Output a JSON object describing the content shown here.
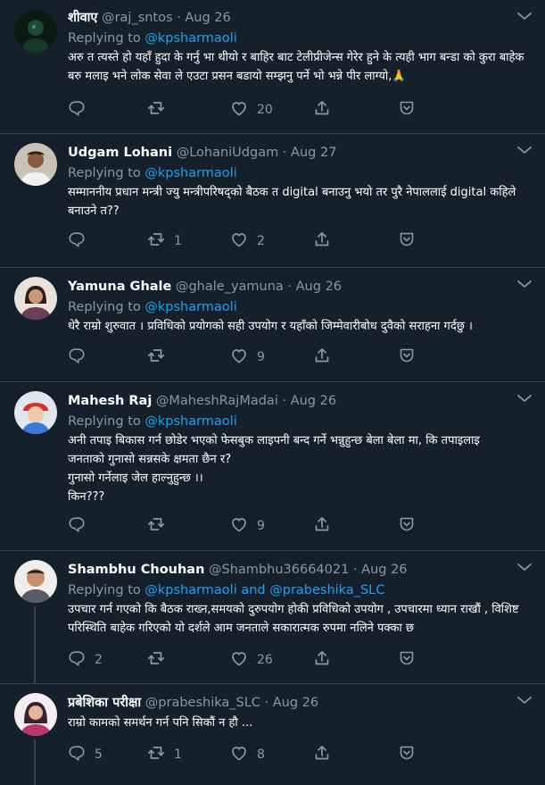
{
  "tweets": [
    {
      "name": "शीवाए",
      "handle": "@raj_sntos",
      "dot": "·",
      "time": "Aug 26",
      "reply_prefix": "Replying to",
      "mentions": "@kpsharmaoli",
      "body": "अरु त त्यस्ते हो यहाँ हुदा के गर्नु भा थीयो र बाहिर बाट टेलीप्रीजेन्स गेरेर हुने के त्यही भाग बन्डा को कुरा बाहेक बरु मलाइ भने लोक सेवा ले एउटा प्रसन बडायो सम्झनु पर्ने भो भन्ने पीर लाग्यो,🙏",
      "reply_count": "",
      "retweet_count": "",
      "like_count": "20"
    },
    {
      "name": "Udgam Lohani",
      "handle": "@LohaniUdgam",
      "dot": "·",
      "time": "Aug 27",
      "reply_prefix": "Replying to",
      "mentions": "@kpsharmaoli",
      "body": "सम्माननीय प्रधान मन्त्री ज्यु मन्त्रीपरिषद्को बैठक त  digital बनाउनु भयो तर पुरै नेपाललाई digital कहिले बनाउने त??",
      "reply_count": "",
      "retweet_count": "1",
      "like_count": "2"
    },
    {
      "name": "Yamuna Ghale",
      "handle": "@ghale_yamuna",
      "dot": "·",
      "time": "Aug 26",
      "reply_prefix": "Replying to",
      "mentions": "@kpsharmaoli",
      "body": "धेरै राम्रो शुरुवात । प्रविधिको प्रयोगको सही उपयोग र यहाँको जिम्मेवारीबोध दुवैको सराहना गर्दछु ।",
      "reply_count": "",
      "retweet_count": "",
      "like_count": "9"
    },
    {
      "name": "Mahesh Raj",
      "handle": "@MaheshRajMadai",
      "dot": "·",
      "time": "Aug 26",
      "reply_prefix": "Replying to",
      "mentions": "@kpsharmaoli",
      "body_lines": [
        "अनी तपाइ बिकास गर्न छोडेर भएको फेसबुक लाइपनी बन्द गर्ने भन्नुहुन्छ बेला बेला मा, कि तपाइलाइ",
        "जनताको गुनासो सन्नसके क्षमता छैन र?",
        "गुनासो गर्नेलाइ जेल हाल्नुहुन्छ ।।",
        "किन???"
      ],
      "reply_count": "",
      "retweet_count": "",
      "like_count": "9"
    },
    {
      "name": "Shambhu Chouhan",
      "handle": "@Shambhu36664021",
      "dot": "·",
      "time": "Aug 26",
      "reply_prefix": "Replying to",
      "mentions": "@kpsharmaoli and @prabeshika_SLC",
      "body": "उपचार गर्न गएको कि बैठक राख्न,समयको दुरुपयोग होकी प्रविधिको उपयोग , उपचारमा ध्यान राखौं , विशिष्ट परिस्थिति बाहेक गरिएको यो दर्शले आम जनताले सकारात्मक रुपमा नलिने पक्का छ",
      "reply_count": "2",
      "retweet_count": "",
      "like_count": "26"
    },
    {
      "name": "प्रबेशिका परीक्षा",
      "handle": "@prabeshika_SLC",
      "dot": "·",
      "time": "Aug 26",
      "body": "राम्रो कामको समर्थन गर्न पनि सिकौं न हौ ...",
      "reply_count": "5",
      "retweet_count": "1",
      "like_count": "8"
    }
  ],
  "colors": {
    "background": "#15202b",
    "divider": "#38444d",
    "muted": "#8899a6",
    "link": "#1da1f2",
    "text": "#ffffff"
  },
  "icons": [
    "reply-icon",
    "retweet-icon",
    "like-icon",
    "share-icon",
    "more-icon"
  ]
}
